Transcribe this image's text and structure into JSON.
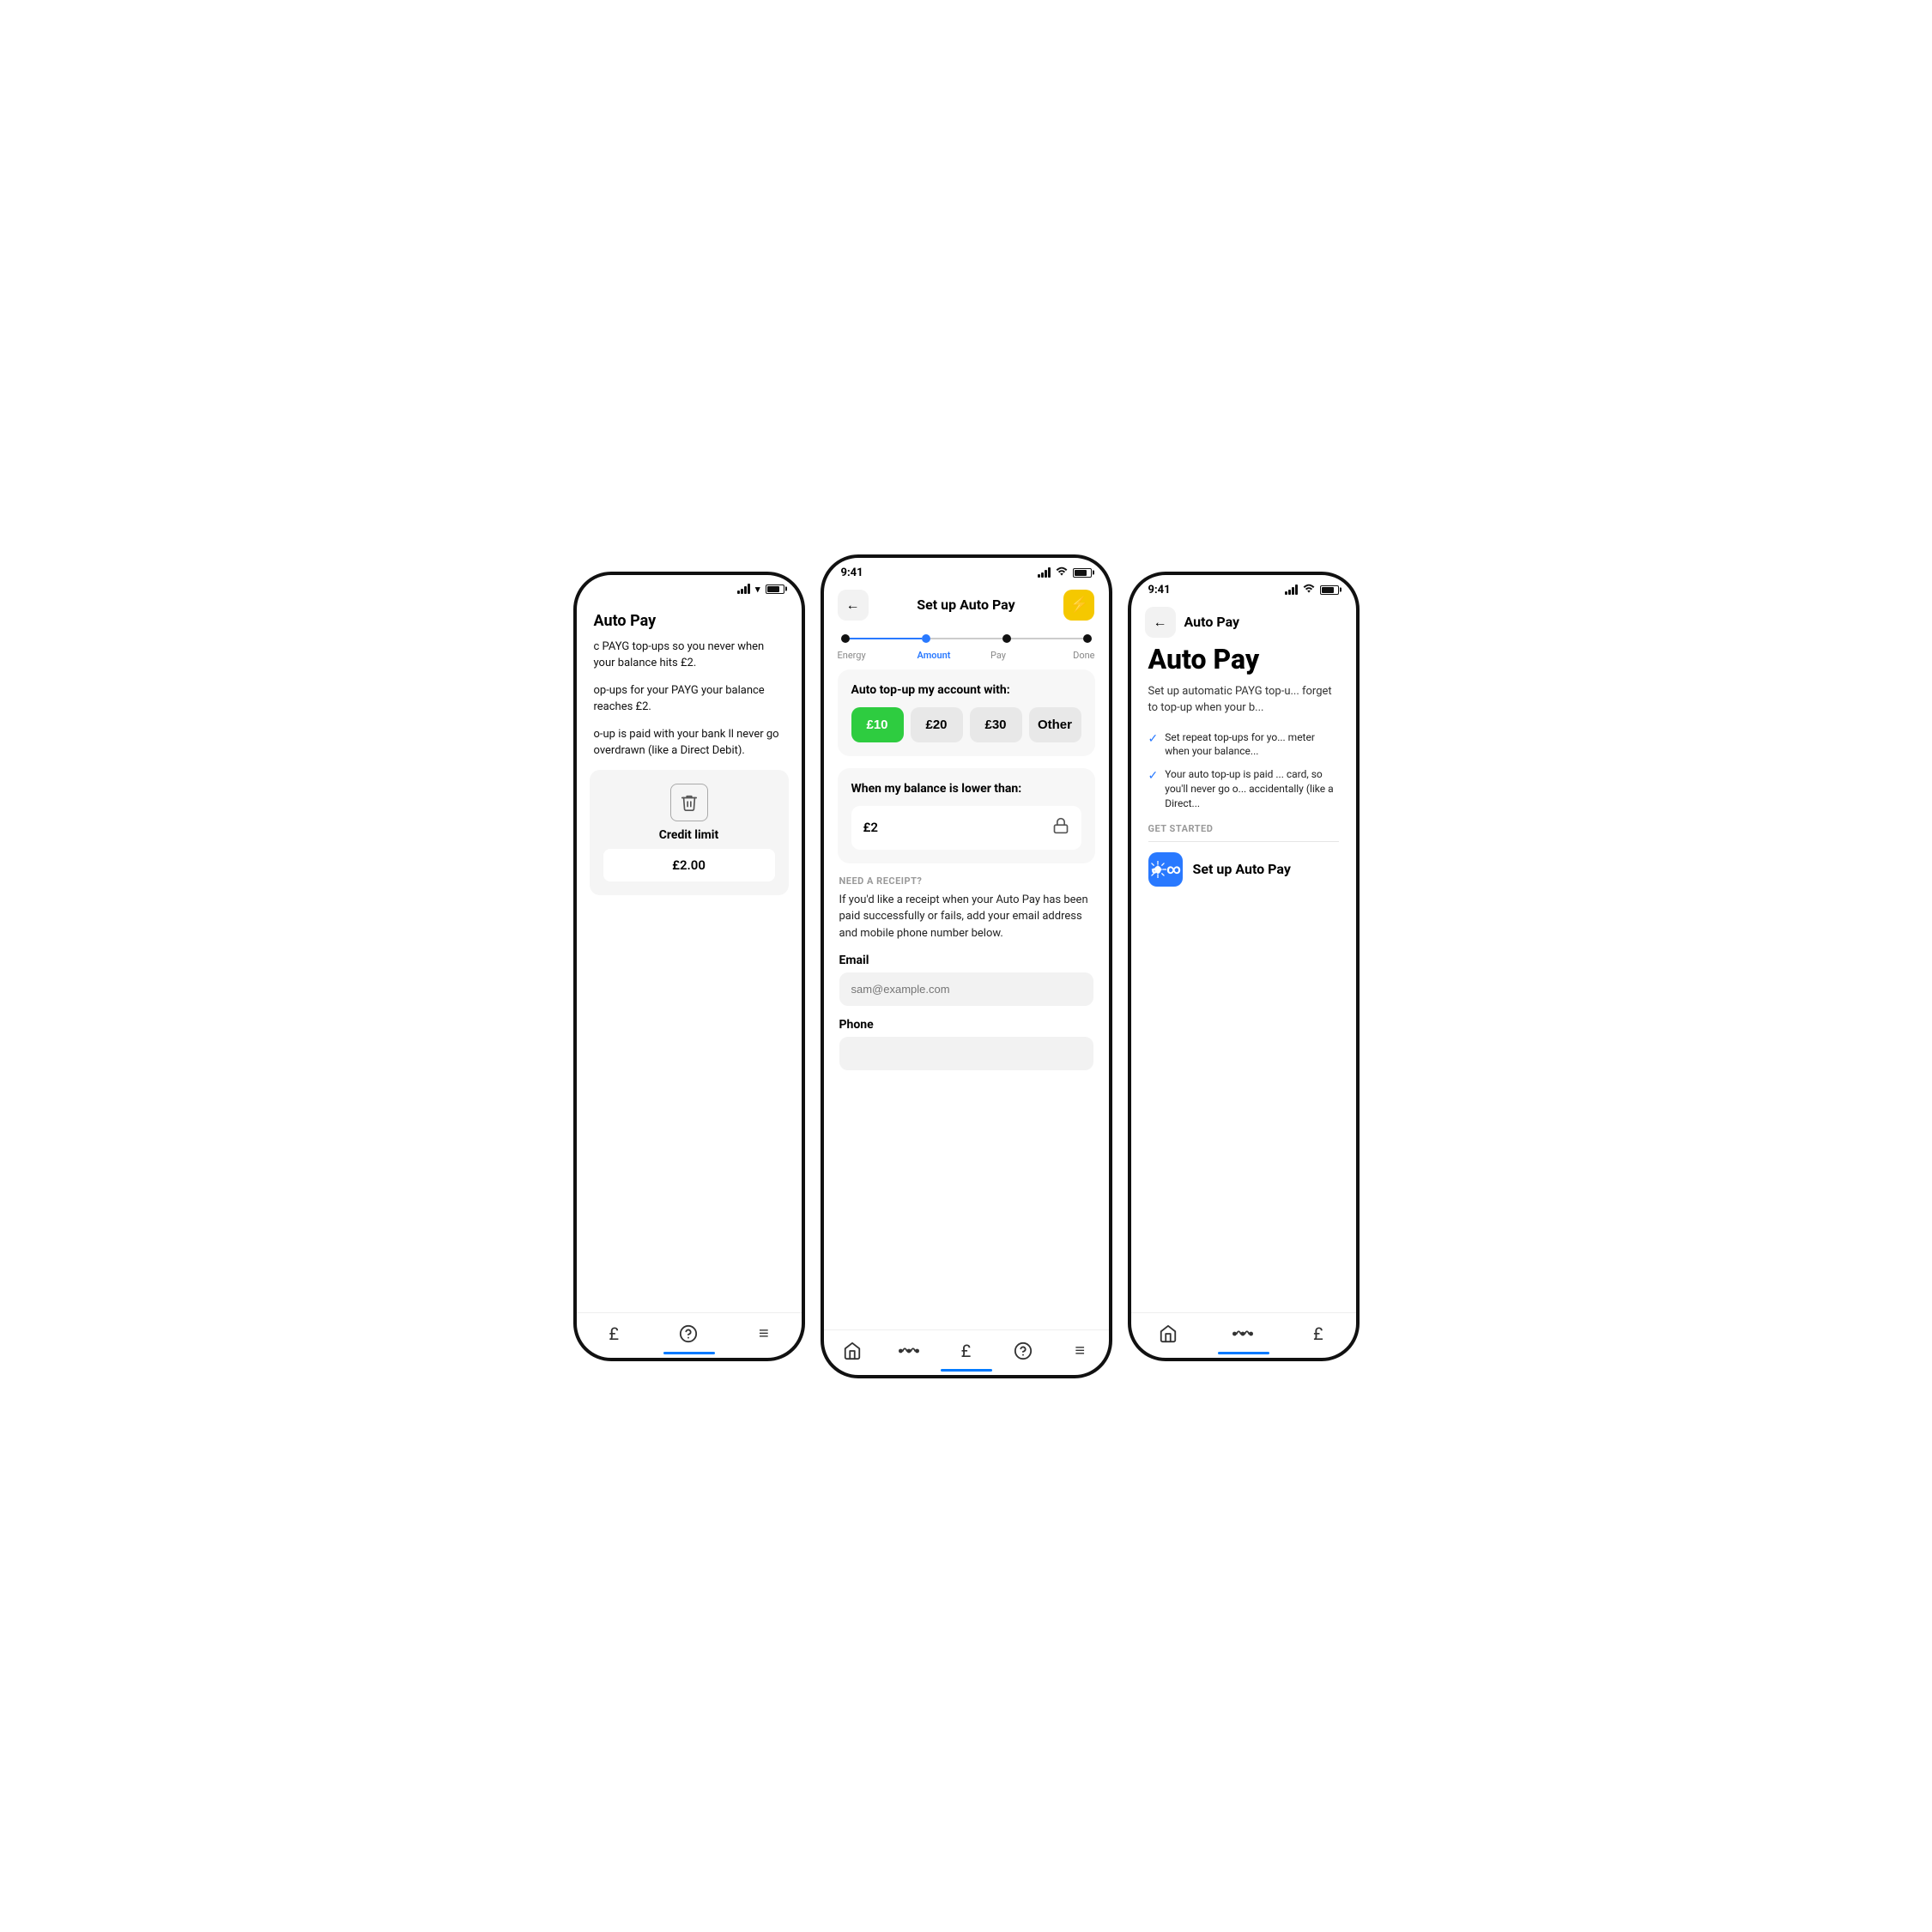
{
  "colors": {
    "accent_blue": "#2979FF",
    "accent_green": "#2ecc40",
    "accent_yellow": "#f5c800",
    "bg_light": "#f7f7f7",
    "border": "#e5e5e5"
  },
  "left_phone": {
    "title": "Auto Pay",
    "description1": "c PAYG top-ups so you never when your balance hits £2.",
    "description2": "op-ups for your PAYG your balance reaches £2.",
    "description3": "o-up is paid with your bank ll never go overdrawn (like a Direct Debit).",
    "credit_limit_label": "Credit limit",
    "credit_limit_value": "£2.00",
    "nav_items": [
      "£",
      "?",
      "≡"
    ]
  },
  "center_phone": {
    "status_time": "9:41",
    "header_title": "Set up Auto Pay",
    "back_label": "←",
    "bolt_icon": "⚡",
    "steps": [
      {
        "label": "Energy",
        "state": "done"
      },
      {
        "label": "Amount",
        "state": "active"
      },
      {
        "label": "Pay",
        "state": "upcoming"
      },
      {
        "label": "Done",
        "state": "upcoming"
      }
    ],
    "amount_section": {
      "title": "Auto top-up my account with:",
      "options": [
        {
          "value": "£10",
          "selected": true
        },
        {
          "value": "£20",
          "selected": false
        },
        {
          "value": "£30",
          "selected": false
        },
        {
          "value": "Other",
          "selected": false
        }
      ]
    },
    "balance_section": {
      "title": "When my balance is lower than:",
      "value": "£2"
    },
    "receipt_section": {
      "label": "NEED A RECEIPT?",
      "description": "If you'd like a receipt when your Auto Pay has been paid successfully or fails, add your email address and mobile phone number below."
    },
    "email_field": {
      "label": "Email",
      "placeholder": "sam@example.com"
    },
    "phone_field": {
      "label": "Phone",
      "placeholder": ""
    },
    "nav_items": [
      "🏠",
      "⚡",
      "£",
      "?",
      "≡"
    ]
  },
  "right_phone": {
    "status_time": "9:41",
    "header_title": "Auto Pay",
    "back_label": "←",
    "big_title": "Auto Pay",
    "description": "Set up automatic PAYG top-u... forget to top-up when your b...",
    "check_items": [
      "Set repeat top-ups for yo... meter when your balance...",
      "Your auto top-up is paid ... card, so you'll never go o... accidentally (like a Direct..."
    ],
    "get_started_label": "GET STARTED",
    "setup_button_label": "Set up Auto Pay",
    "nav_items": [
      "🏠",
      "⚡",
      "£"
    ]
  }
}
